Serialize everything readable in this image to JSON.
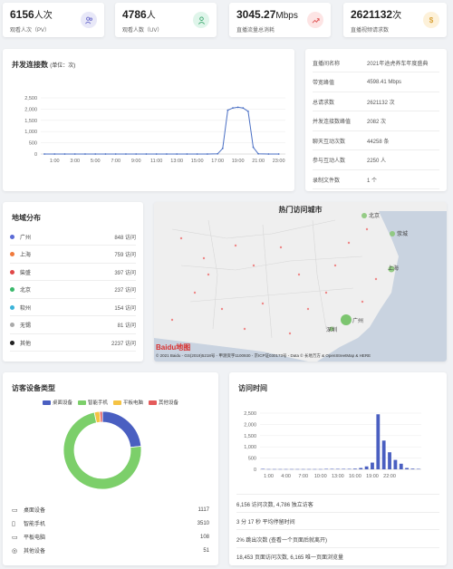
{
  "stats": [
    {
      "value": "6156",
      "unit": "人次",
      "label": "观看人次（PV）",
      "icon": "users-icon",
      "icon_bg": "#e8e8f8",
      "icon_color": "#6b6bcb",
      "glyph": "👥"
    },
    {
      "value": "4786",
      "unit": "人",
      "label": "观看人数（UV）",
      "icon": "user-icon",
      "icon_bg": "#dff5ea",
      "icon_color": "#3aa76d",
      "glyph": "👤"
    },
    {
      "value": "3045.27",
      "unit": "Mbps",
      "label": "直播流量总消耗",
      "icon": "trend-up-icon",
      "icon_bg": "#fde4e4",
      "icon_color": "#e05555",
      "glyph": "↗"
    },
    {
      "value": "2621132",
      "unit": "次",
      "label": "直播视频请求数",
      "icon": "dollar-icon",
      "icon_bg": "#fdf1d9",
      "icon_color": "#d9a33a",
      "glyph": "$"
    }
  ],
  "concurrent": {
    "title": "并发连接数",
    "unit_note": "(单位：次)",
    "chart_data": {
      "type": "line",
      "x": [
        "0:00",
        "1:00",
        "2:00",
        "3:00",
        "4:00",
        "5:00",
        "6:00",
        "7:00",
        "8:00",
        "9:00",
        "10:00",
        "11:00",
        "12:00",
        "13:00",
        "14:00",
        "15:00",
        "16:00",
        "17:00",
        "17:30",
        "18:00",
        "18:30",
        "19:00",
        "19:30",
        "20:00",
        "20:30",
        "21:00",
        "22:00",
        "23:00"
      ],
      "values": [
        0,
        0,
        0,
        0,
        0,
        0,
        0,
        0,
        0,
        0,
        0,
        0,
        0,
        0,
        0,
        0,
        0,
        10,
        250,
        1950,
        2050,
        2080,
        2050,
        1900,
        300,
        10,
        0,
        0
      ],
      "xticks": [
        "1:00",
        "3:00",
        "5:00",
        "7:00",
        "9:00",
        "11:00",
        "13:00",
        "15:00",
        "17:00",
        "19:00",
        "21:00",
        "23:00"
      ],
      "yticks": [
        "0",
        "500",
        "1,000",
        "1,500",
        "2,000",
        "2,500"
      ],
      "ylim": [
        0,
        2500
      ]
    }
  },
  "info": [
    {
      "k": "直播间名称",
      "v": "2021年途虎养车年度盛典"
    },
    {
      "k": "带宽峰值",
      "v": "4598.41 Mbps"
    },
    {
      "k": "总请求数",
      "v": "2621132 次"
    },
    {
      "k": "并发连接数峰值",
      "v": "2082 次"
    },
    {
      "k": "聊天互动次数",
      "v": "44258 条"
    },
    {
      "k": "参与互动人数",
      "v": "2250 人"
    },
    {
      "k": "录制文件数",
      "v": "1 个"
    }
  ],
  "region": {
    "title": "地域分布",
    "rows": [
      {
        "name": "广州",
        "value": "848 访问",
        "color": "#5b6bd6"
      },
      {
        "name": "上海",
        "value": "759 访问",
        "color": "#f07a3c"
      },
      {
        "name": "柴盛",
        "value": "397 访问",
        "color": "#e04848"
      },
      {
        "name": "北京",
        "value": "237 访问",
        "color": "#3ab86b"
      },
      {
        "name": "软州",
        "value": "154 访问",
        "color": "#3bb3d9"
      },
      {
        "name": "无锡",
        "value": "81 访问",
        "color": "#aaaaaa"
      },
      {
        "name": "其他",
        "value": "2237 访问",
        "color": "#222222"
      }
    ]
  },
  "map": {
    "title": "热门访问城市",
    "cities": [
      {
        "name": "北京",
        "big": false
      },
      {
        "name": "荥城",
        "big": false
      },
      {
        "name": "上海",
        "big": false
      },
      {
        "name": "广州",
        "big": true
      },
      {
        "name": "深圳",
        "big": false
      }
    ],
    "logo": "Baidu地图",
    "copyright": "© 2021 Baidu - GS(2019)5218号 - 甲测资字1100930 - 京ICP证030173号 - Data © 长地万方 & OpenStreetMap & HERE"
  },
  "device": {
    "title": "访客设备类型",
    "legend": [
      {
        "name": "桌面设备",
        "color": "#4a5fc1"
      },
      {
        "name": "智能手机",
        "color": "#7ccf6a"
      },
      {
        "name": "平板电脑",
        "color": "#f5c344"
      },
      {
        "name": "其他设备",
        "color": "#e45a5a"
      }
    ],
    "chart_data": {
      "type": "pie",
      "labels": [
        "桌面设备",
        "智能手机",
        "平板电脑",
        "其他设备"
      ],
      "values": [
        1117,
        3510,
        108,
        51
      ]
    },
    "rows": [
      {
        "icon": "desktop-icon",
        "glyph": "▭",
        "name": "桌面设备",
        "value": "1117"
      },
      {
        "icon": "phone-icon",
        "glyph": "▯",
        "name": "智能手机",
        "value": "3510"
      },
      {
        "icon": "tablet-icon",
        "glyph": "▭",
        "name": "平板电脑",
        "value": "108"
      },
      {
        "icon": "globe-icon",
        "glyph": "◎",
        "name": "其他设备",
        "value": "51"
      }
    ]
  },
  "visit": {
    "title": "访问时间",
    "chart_data": {
      "type": "bar",
      "values": [
        20,
        10,
        10,
        10,
        10,
        10,
        10,
        10,
        10,
        10,
        10,
        20,
        20,
        20,
        20,
        20,
        30,
        60,
        130,
        300,
        2450,
        1280,
        760,
        420,
        250,
        60,
        30,
        20
      ],
      "xticks": [
        "1:00",
        "4:00",
        "7:00",
        "10:00",
        "13:00",
        "16:00",
        "19:00",
        "22:00"
      ],
      "yticks": [
        "0",
        "500",
        "1,000",
        "1,500",
        "2,000",
        "2,500"
      ],
      "ylim": [
        0,
        2500
      ]
    },
    "rows": [
      "6,156 访问次数, 4,786 独立访客",
      "3 分 17 秒 平均停留时间",
      "2% 跳出次数 (查看一个页面后就离开)",
      "18,453 页面访问次数, 6,165 唯一页面浏览量"
    ]
  }
}
